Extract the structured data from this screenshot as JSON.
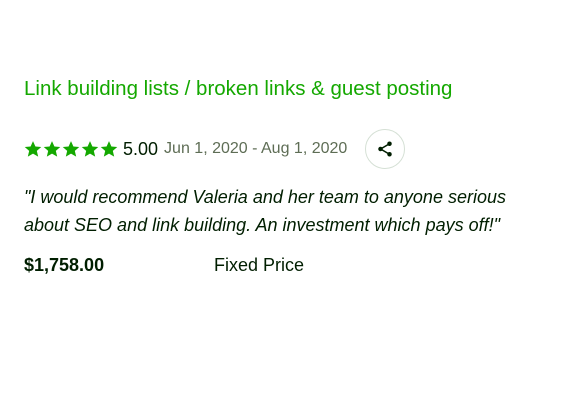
{
  "job": {
    "title": "Link building lists / broken links & guest posting"
  },
  "rating": {
    "stars": 5,
    "max_stars": 5,
    "score": "5.00",
    "dates": "Jun 1, 2020 - Aug 1, 2020",
    "star_icon": "star-icon",
    "share_icon": "share-icon"
  },
  "review": {
    "text": "\"I would recommend Valeria and her team to anyone serious about SEO and link building. An investment which pays off!\""
  },
  "contract": {
    "amount": "$1,758.00",
    "type": "Fixed Price"
  },
  "colors": {
    "title_green": "#14a800",
    "star_green": "#14a800",
    "text_dark": "#001e00",
    "text_muted": "#5e6d55",
    "border": "#d5e0d5"
  }
}
